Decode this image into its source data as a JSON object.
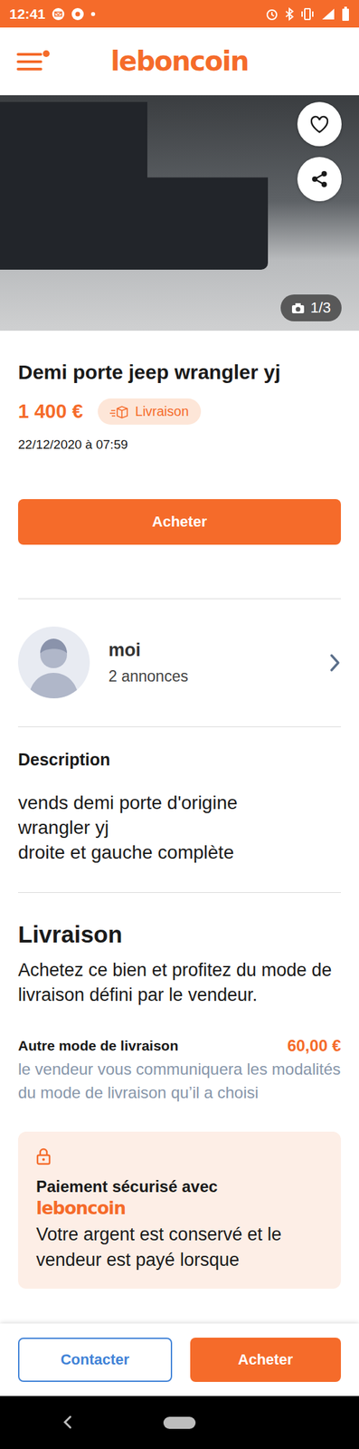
{
  "status_bar": {
    "time": "12:41"
  },
  "header": {
    "logo": "leboncoin"
  },
  "photo": {
    "counter": "1/3",
    "favorite": false
  },
  "listing": {
    "title": "Demi porte jeep wrangler yj",
    "price": "1 400 €",
    "badge": "Livraison",
    "date": "22/12/2020 à 07:59"
  },
  "buy_button": "Acheter",
  "seller": {
    "name": "moi",
    "count": "2 annonces"
  },
  "description": {
    "heading": "Description",
    "lines": [
      "vends demi porte d'origine",
      "wrangler yj",
      "droite et gauche complète"
    ]
  },
  "delivery": {
    "heading": "Livraison",
    "text": "Achetez ce bien et profitez du mode de livraison défini par le vendeur.",
    "option_label": "Autre mode de livraison",
    "option_price": "60,00 €",
    "option_note": "le vendeur vous communiquera les modalités du mode de livraison qu’il a choisi"
  },
  "secure": {
    "title": "Paiement sécurisé avec",
    "logo": "leboncoin",
    "text": "Votre argent est conservé et le vendeur est payé lorsque"
  },
  "bottom_bar": {
    "contact": "Contacter",
    "buy": "Acheter"
  }
}
